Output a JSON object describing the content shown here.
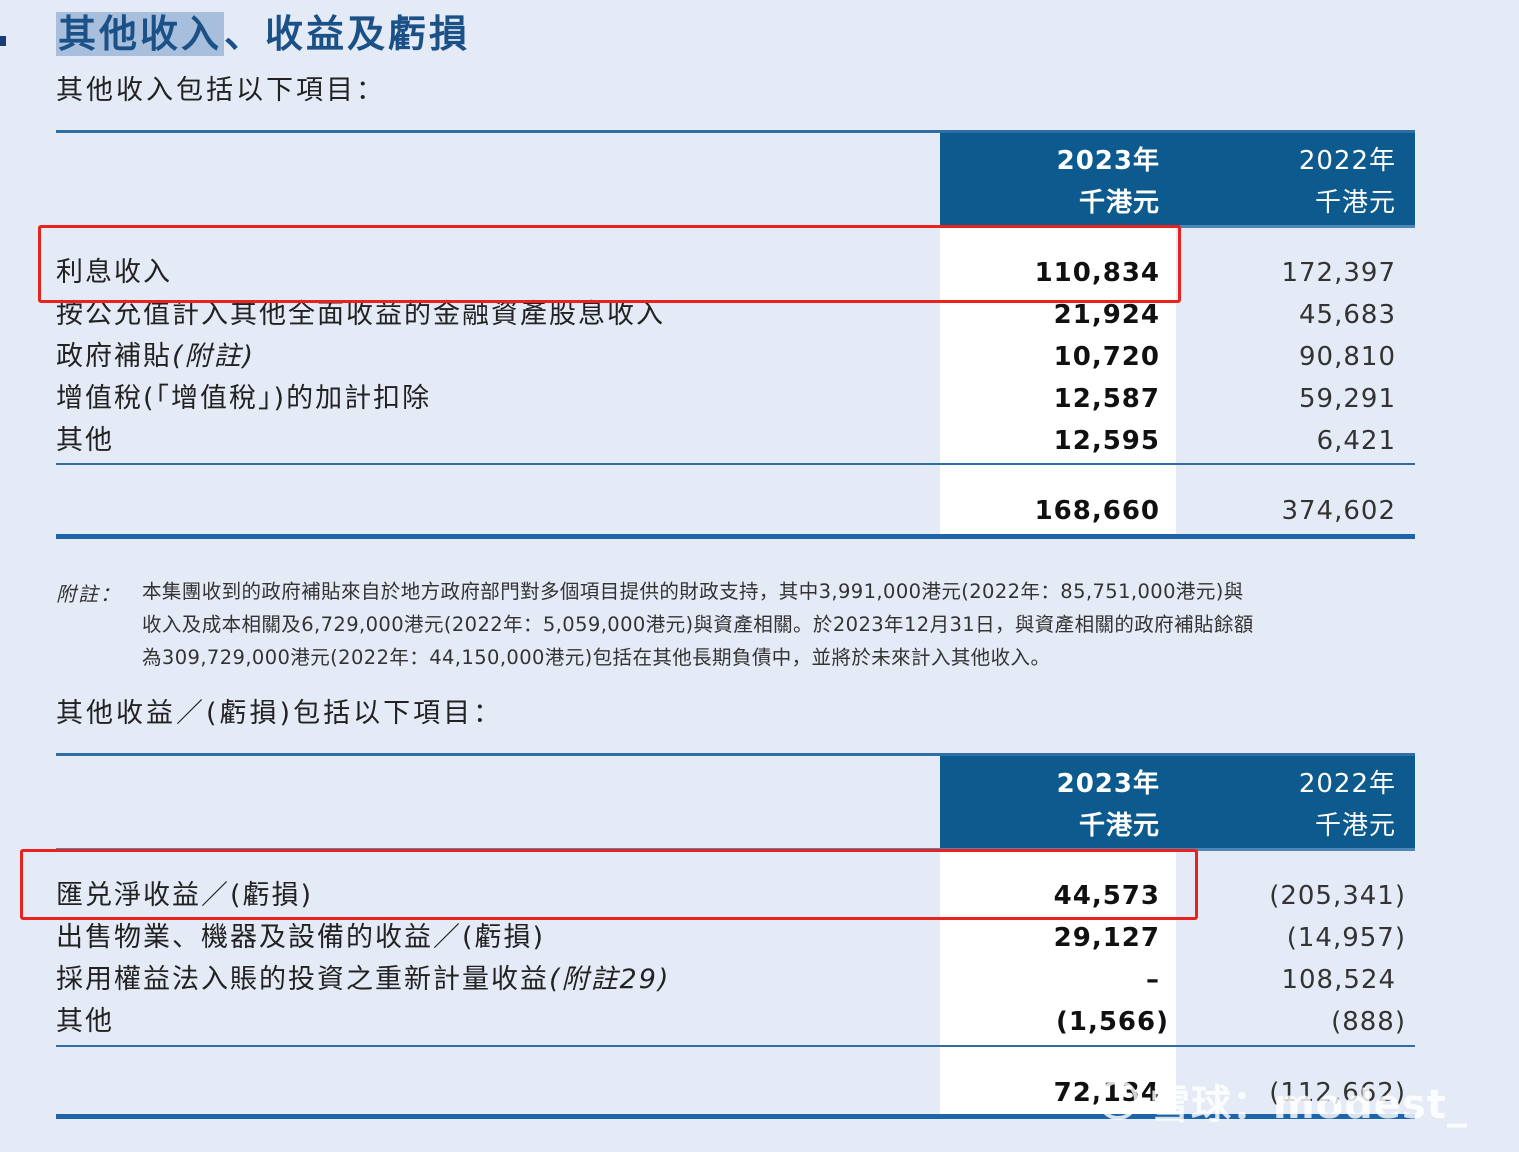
{
  "heading": {
    "highlighted": "其他收入",
    "rest": "、收益及虧損"
  },
  "section1": {
    "intro": "其他收入包括以下項目：",
    "header": {
      "year_current": "2023年",
      "unit_current": "千港元",
      "year_prior": "2022年",
      "unit_prior": "千港元"
    },
    "rows": [
      {
        "label": "利息收入",
        "note": "",
        "v2023": "110,834",
        "v2022": "172,397"
      },
      {
        "label": "按公允值計入其他全面收益的金融資產股息收入",
        "note": "",
        "v2023": "21,924",
        "v2022": "45,683"
      },
      {
        "label": "政府補貼",
        "note": "(附註)",
        "v2023": "10,720",
        "v2022": "90,810"
      },
      {
        "label": "增值稅(「增值稅」)的加計扣除",
        "note": "",
        "v2023": "12,587",
        "v2022": "59,291"
      },
      {
        "label": "其他",
        "note": "",
        "v2023": "12,595",
        "v2022": "6,421"
      }
    ],
    "total": {
      "v2023": "168,660",
      "v2022": "374,602"
    }
  },
  "note": {
    "label": "附註：",
    "lines": [
      "本集團收到的政府補貼來自於地方政府部門對多個項目提供的財政支持，其中3,991,000港元(2022年：85,751,000港元)與",
      "收入及成本相關及6,729,000港元(2022年：5,059,000港元)與資產相關。於2023年12月31日，與資產相關的政府補貼餘額",
      "為309,729,000港元(2022年：44,150,000港元)包括在其他長期負債中，並將於未來計入其他收入。"
    ]
  },
  "section2": {
    "intro": "其他收益／(虧損)包括以下項目：",
    "header": {
      "year_current": "2023年",
      "unit_current": "千港元",
      "year_prior": "2022年",
      "unit_prior": "千港元"
    },
    "rows": [
      {
        "label": "匯兑淨收益／(虧損)",
        "note": "",
        "v2023": "44,573",
        "v2022": "(205,341)"
      },
      {
        "label": "出售物業、機器及設備的收益／(虧損)",
        "note": "",
        "v2023": "29,127",
        "v2022": "(14,957)"
      },
      {
        "label": "採用權益法入賬的投資之重新計量收益",
        "note": "(附註29)",
        "v2023": "–",
        "v2022": "108,524"
      },
      {
        "label": "其他",
        "note": "",
        "v2023": "(1,566)",
        "v2022": "(888)"
      }
    ],
    "total": {
      "v2023": "72,134",
      "v2022": "(112,662)"
    }
  },
  "watermark": "雪球：modest_"
}
